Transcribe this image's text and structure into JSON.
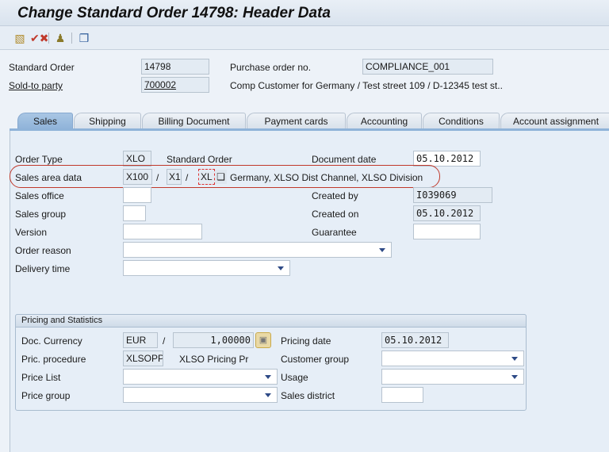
{
  "window": {
    "title": "Change Standard Order 14798: Header Data"
  },
  "toolbar": {
    "icons": [
      "display-document-flow-icon",
      "check-cancel-icon",
      "partner-person-icon",
      "document-overview-icon"
    ]
  },
  "header": {
    "standard_order_label": "Standard Order",
    "standard_order_value": "14798",
    "po_label": "Purchase order no.",
    "po_value": "COMPLIANCE_001",
    "sold_to_label": "Sold-to party",
    "sold_to_value": "700002",
    "sold_to_desc": "Comp Customer for Germany / Test street 109 / D-12345 test st.."
  },
  "tabs": [
    {
      "label": "Sales",
      "active": true
    },
    {
      "label": "Shipping"
    },
    {
      "label": "Billing Document"
    },
    {
      "label": "Payment cards"
    },
    {
      "label": "Accounting"
    },
    {
      "label": "Conditions"
    },
    {
      "label": "Account assignment"
    }
  ],
  "sales": {
    "order_type_label": "Order Type",
    "order_type_value": "XLO",
    "order_type_desc": "Standard Order",
    "doc_date_label": "Document date",
    "doc_date_value": "05.10.2012",
    "sales_area_label": "Sales area data",
    "sales_org": "X100",
    "dist_channel": "X1",
    "division": "XL",
    "slash": "/",
    "sales_area_desc": "Germany, XLSO Dist Channel, XLSO Division",
    "highlight_color": "#c0392b",
    "sales_office_label": "Sales office",
    "sales_office_value": "",
    "created_by_label": "Created by",
    "created_by_value": "I039069",
    "sales_group_label": "Sales group",
    "sales_group_value": "",
    "created_on_label": "Created on",
    "created_on_value": "05.10.2012",
    "version_label": "Version",
    "version_value": "",
    "guarantee_label": "Guarantee",
    "guarantee_value": "",
    "order_reason_label": "Order reason",
    "order_reason_value": "",
    "delivery_time_label": "Delivery time",
    "delivery_time_value": ""
  },
  "pricing": {
    "title": "Pricing and Statistics",
    "doc_currency_label": "Doc. Currency",
    "currency": "EUR",
    "exchange_rate": "1,00000",
    "pricing_date_label": "Pricing date",
    "pricing_date_value": "05.10.2012",
    "pric_proc_label": "Pric. procedure",
    "pric_proc_value": "XLSOPP",
    "pric_proc_desc": "XLSO Pricing Pr",
    "customer_group_label": "Customer group",
    "customer_group_value": "",
    "price_list_label": "Price List",
    "price_list_value": "",
    "usage_label": "Usage",
    "usage_value": "",
    "price_group_label": "Price group",
    "price_group_value": "",
    "sales_district_label": "Sales district",
    "sales_district_value": ""
  }
}
